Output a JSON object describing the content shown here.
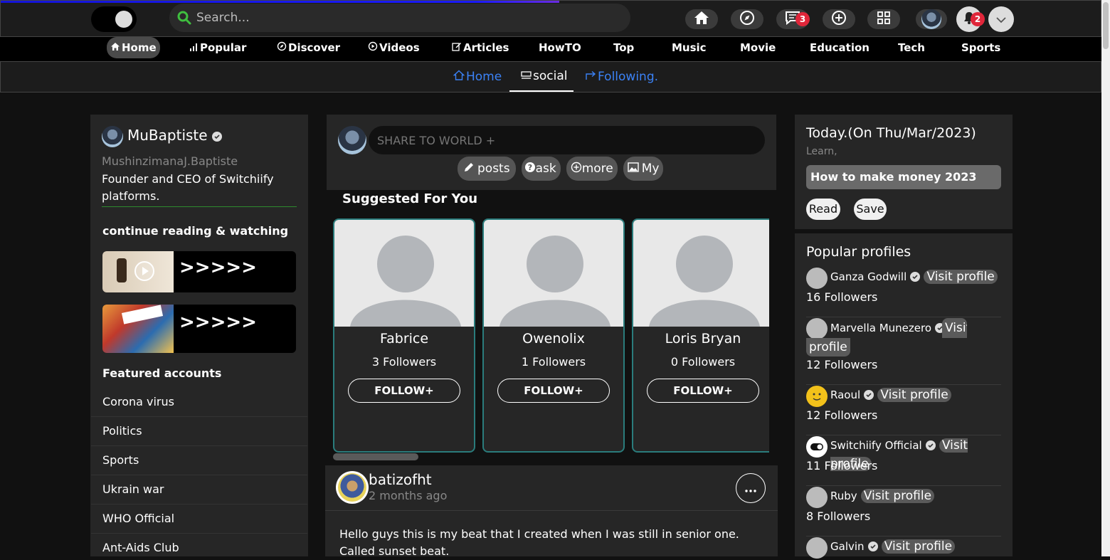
{
  "search": {
    "placeholder": "Search..."
  },
  "header_badges": {
    "messages": "3",
    "notifications": "2"
  },
  "nav_main": [
    {
      "label": "Home"
    },
    {
      "label": "Popular"
    },
    {
      "label": "Discover"
    },
    {
      "label": "Videos"
    },
    {
      "label": "Articles"
    },
    {
      "label": "HowTO"
    },
    {
      "label": "Top"
    },
    {
      "label": "Music"
    },
    {
      "label": "Movie"
    },
    {
      "label": "Education"
    },
    {
      "label": "Tech"
    },
    {
      "label": "Sports"
    }
  ],
  "nav_sub": [
    {
      "label": "Home"
    },
    {
      "label": "social"
    },
    {
      "label": "Following."
    }
  ],
  "profile": {
    "username": "MuBaptiste",
    "fullname": "MushinzimanaJ.Baptiste",
    "bio": "Founder and CEO of Switchiify platforms."
  },
  "continue": {
    "title": "continue reading & watching",
    "items": [
      {
        "label": ">>>>>"
      },
      {
        "label": ">>>>>"
      }
    ]
  },
  "featured": {
    "title": "Featured accounts",
    "items": [
      "Corona virus",
      "Politics",
      "Sports",
      "Ukrain war",
      "WHO Official",
      "Ant-Aids Club"
    ]
  },
  "composer": {
    "placeholder": "SHARE TO WORLD +",
    "actions": [
      "posts",
      "ask",
      "more",
      "My"
    ]
  },
  "suggested": {
    "title": "Suggested For You",
    "cards": [
      {
        "name": "Fabrice",
        "followers": "3 Followers",
        "button": "FOLLOW+"
      },
      {
        "name": "Owenolix",
        "followers": "1 Followers",
        "button": "FOLLOW+"
      },
      {
        "name": "Loris Bryan",
        "followers": "0 Followers",
        "button": "FOLLOW+"
      }
    ]
  },
  "post": {
    "author": "batizofht",
    "time": "2 months ago",
    "text": "Hello guys this is my beat that I created when I was still in senior one. Called sunset beat."
  },
  "today": {
    "title": "Today.(On Thu/Mar/2023)",
    "subtitle": "Learn,",
    "headline": "How to make money 2023",
    "read": "Read",
    "save": "Save"
  },
  "popular": {
    "title": "Popular profiles",
    "visit_label": "Visit profile",
    "items": [
      {
        "name": "Ganza Godwill",
        "followers": "16 Followers"
      },
      {
        "name": "Marvella Munezero",
        "followers": "12 Followers"
      },
      {
        "name": "Raoul",
        "followers": "12 Followers"
      },
      {
        "name": "Switchiify Official",
        "followers": "11 Followers"
      },
      {
        "name": "Ruby",
        "followers": "8 Followers"
      },
      {
        "name": "Galvin",
        "followers": ""
      }
    ]
  },
  "colors": {
    "accent_blue": "#3b82f6",
    "badge_red": "#e0263a",
    "card_border": "#2a7c7c"
  }
}
